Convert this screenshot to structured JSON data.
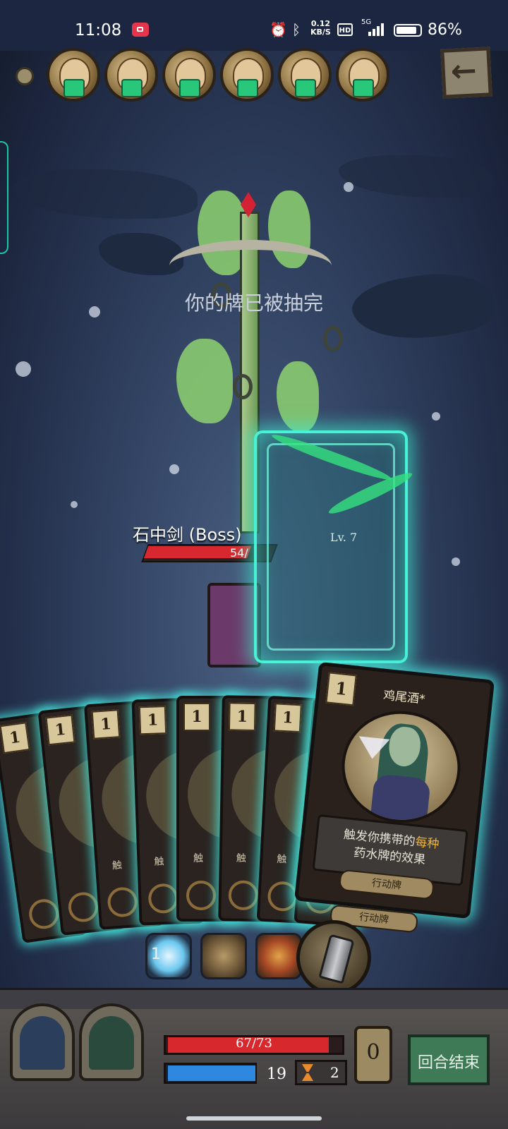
{
  "status_bar": {
    "time": "11:08",
    "net_speed_value": "0.12",
    "net_speed_unit": "KB/S",
    "hd": "HD",
    "network": "5G",
    "battery": "86%"
  },
  "relics": [
    {
      "name": "relic-potion-mage"
    },
    {
      "name": "relic-potion-mage"
    },
    {
      "name": "relic-potion-mage"
    },
    {
      "name": "relic-potion-mage"
    },
    {
      "name": "relic-potion-mage"
    },
    {
      "name": "relic-potion-mage"
    }
  ],
  "back_icon": "←",
  "message": "你的牌已被抽完",
  "boss": {
    "name": "石中剑 (Boss)",
    "hp_text": "54/",
    "hp_fraction": 0.83
  },
  "intent": {
    "level": "Lv. 7"
  },
  "hand": {
    "background_cards": [
      {
        "cost": "1",
        "text": ""
      },
      {
        "cost": "1",
        "text": ""
      },
      {
        "cost": "1",
        "text": "触"
      },
      {
        "cost": "1",
        "text": "触"
      },
      {
        "cost": "1",
        "text": "触"
      },
      {
        "cost": "1",
        "text": "触"
      },
      {
        "cost": "1",
        "text": "触"
      },
      {
        "cost": "1",
        "text": ""
      }
    ],
    "selected_card": {
      "cost": "1",
      "title": "鸡尾酒*",
      "desc_part1": "触发你携带的",
      "desc_highlight": "每种",
      "desc_part2": "药水牌的效果",
      "type": "行动牌"
    },
    "under_card_type": "行动牌"
  },
  "potions": {
    "count": "1"
  },
  "player": {
    "hp_text": "67/73",
    "hp_fraction": 0.918,
    "energy": "19",
    "hourglass": "2",
    "discard_count": "0"
  },
  "end_turn_label": "回合结束",
  "colors": {
    "hp": "#d7282e",
    "energy": "#2e88e0",
    "card_glow": "#48f2d5",
    "highlight": "#f0b23a"
  }
}
